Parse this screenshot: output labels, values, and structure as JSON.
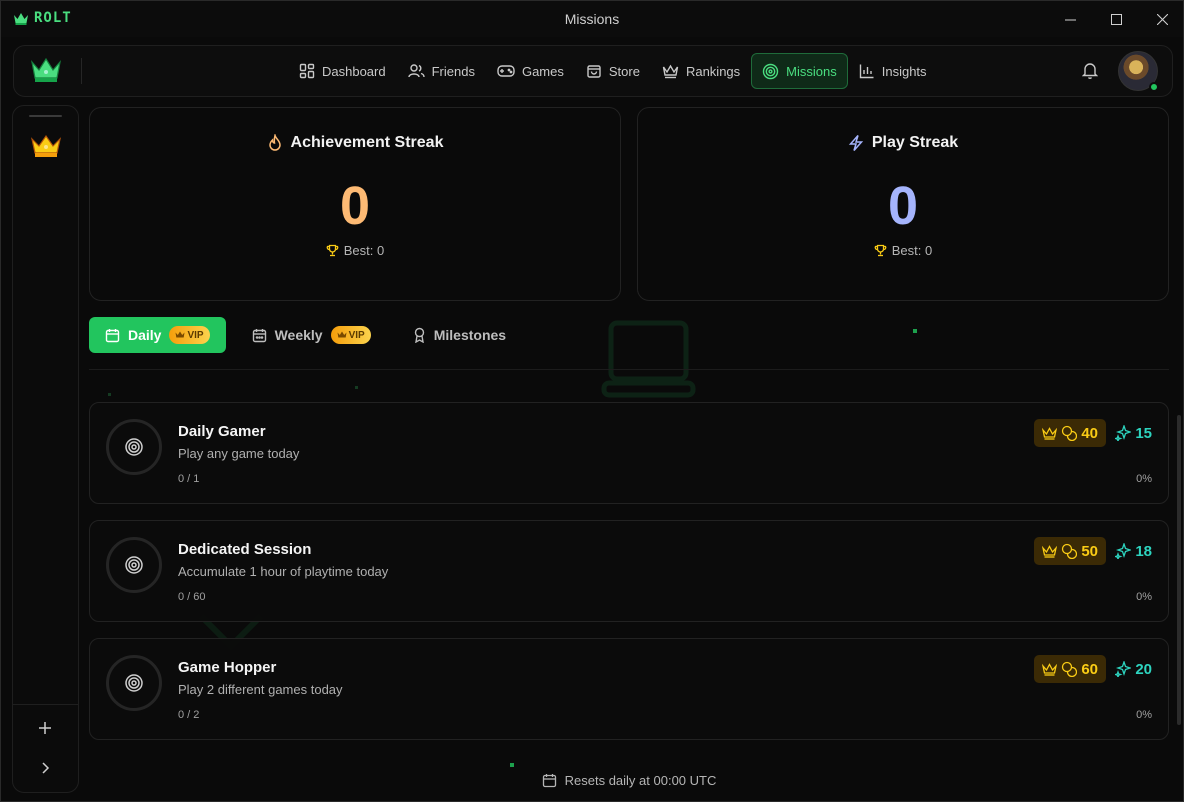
{
  "app": {
    "logo_text": "ROLT",
    "window_title": "Missions"
  },
  "nav": {
    "items": [
      {
        "label": "Dashboard",
        "icon": "grid-icon",
        "active": false
      },
      {
        "label": "Friends",
        "icon": "users-icon",
        "active": false
      },
      {
        "label": "Games",
        "icon": "gamepad-icon",
        "active": false
      },
      {
        "label": "Store",
        "icon": "bag-icon",
        "active": false
      },
      {
        "label": "Rankings",
        "icon": "crown-icon",
        "active": false
      },
      {
        "label": "Missions",
        "icon": "target-icon",
        "active": true
      },
      {
        "label": "Insights",
        "icon": "bar-chart-icon",
        "active": false
      }
    ]
  },
  "streaks": {
    "achievement": {
      "title": "Achievement Streak",
      "value": "0",
      "best": "Best: 0"
    },
    "play": {
      "title": "Play Streak",
      "value": "0",
      "best": "Best: 0"
    }
  },
  "tabs": {
    "daily": {
      "label": "Daily",
      "badge": "VIP"
    },
    "weekly": {
      "label": "Weekly",
      "badge": "VIP"
    },
    "milestones": {
      "label": "Milestones"
    }
  },
  "missions": [
    {
      "title": "Daily Gamer",
      "desc": "Play any game today",
      "progress": "0 / 1",
      "coins": "40",
      "xp": "15",
      "percent": "0%"
    },
    {
      "title": "Dedicated Session",
      "desc": "Accumulate 1 hour of playtime today",
      "progress": "0 / 60",
      "coins": "50",
      "xp": "18",
      "percent": "0%"
    },
    {
      "title": "Game Hopper",
      "desc": "Play 2 different games today",
      "progress": "0 / 2",
      "coins": "60",
      "xp": "20",
      "percent": "0%"
    }
  ],
  "footer": {
    "reset_text": "Resets daily at 00:00 UTC"
  },
  "colors": {
    "accent": "#22c55e",
    "coin": "#facc15",
    "xp": "#2dd4bf",
    "streak_orange": "#fdba74",
    "streak_blue": "#a5b4fc"
  }
}
